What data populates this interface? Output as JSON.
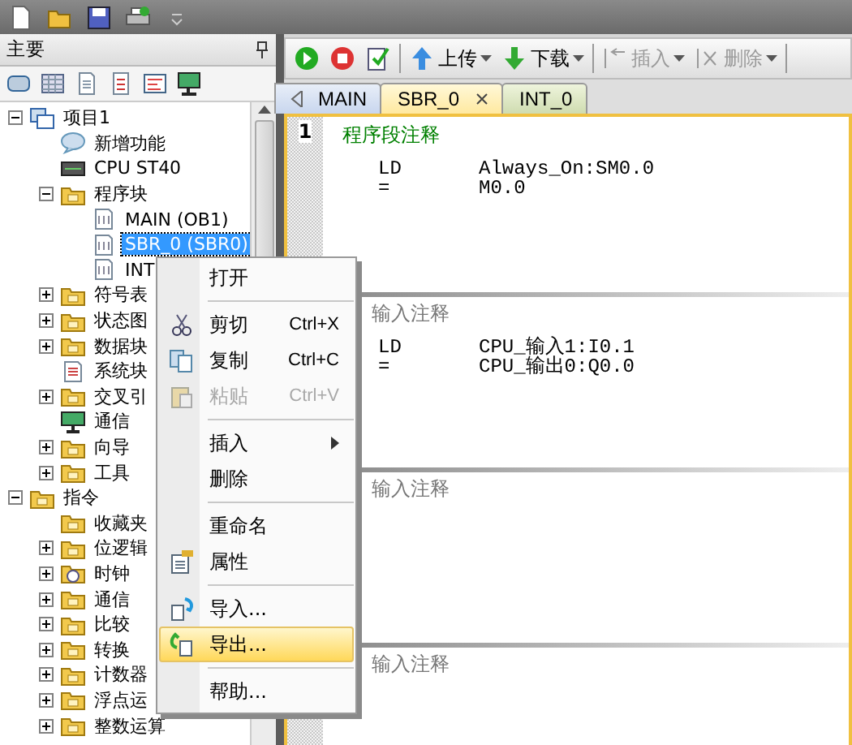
{
  "quick_toolbar": {
    "items": [
      {
        "kind": "new"
      },
      {
        "kind": "open"
      },
      {
        "kind": "save"
      },
      {
        "kind": "print"
      },
      {
        "kind": "more"
      }
    ]
  },
  "left_panel": {
    "title": "主要",
    "icons": [
      {
        "kind": "tag"
      },
      {
        "kind": "grid"
      },
      {
        "kind": "doc"
      },
      {
        "kind": "list"
      },
      {
        "kind": "lines"
      },
      {
        "kind": "monitor"
      }
    ],
    "tree": [
      {
        "label": "项目1",
        "kind": "project",
        "expanded": true,
        "selected": false,
        "children": [
          {
            "label": "新增功能",
            "kind": "help",
            "selected": false
          },
          {
            "label": "CPU ST40",
            "kind": "cpu",
            "selected": false
          },
          {
            "label": "程序块",
            "kind": "folder",
            "expanded": true,
            "selected": false,
            "children": [
              {
                "label": "MAIN (OB1)",
                "kind": "block",
                "selected": false
              },
              {
                "label": "SBR_0 (SBR0)",
                "kind": "block",
                "selected": true
              },
              {
                "label": "INT",
                "kind": "block",
                "selected": false
              }
            ]
          },
          {
            "label": "符号表",
            "kind": "folder",
            "expanded": false,
            "selected": false
          },
          {
            "label": "状态图",
            "kind": "folder",
            "expanded": false,
            "selected": false
          },
          {
            "label": "数据块",
            "kind": "folder",
            "expanded": false,
            "selected": false
          },
          {
            "label": "系统块",
            "kind": "doc",
            "selected": false
          },
          {
            "label": "交叉引",
            "kind": "folder",
            "expanded": false,
            "selected": false
          },
          {
            "label": "通信",
            "kind": "monitor",
            "selected": false
          },
          {
            "label": "向导",
            "kind": "folder",
            "expanded": false,
            "selected": false
          },
          {
            "label": "工具",
            "kind": "folder",
            "expanded": false,
            "selected": false
          }
        ]
      },
      {
        "label": "指令",
        "kind": "folder",
        "expanded": true,
        "selected": false,
        "children": [
          {
            "label": "收藏夹",
            "kind": "folder",
            "selected": false
          },
          {
            "label": "位逻辑",
            "kind": "folder",
            "expanded": false,
            "selected": false
          },
          {
            "label": "时钟",
            "kind": "clock",
            "expanded": false,
            "selected": false
          },
          {
            "label": "通信",
            "kind": "folder",
            "expanded": false,
            "selected": false
          },
          {
            "label": "比较",
            "kind": "folder",
            "expanded": false,
            "selected": false
          },
          {
            "label": "转换",
            "kind": "folder",
            "expanded": false,
            "selected": false
          },
          {
            "label": "计数器",
            "kind": "folder",
            "expanded": false,
            "selected": false
          },
          {
            "label": "浮点运",
            "kind": "folder",
            "expanded": false,
            "selected": false
          },
          {
            "label": "整数运算",
            "kind": "folder",
            "expanded": false,
            "selected": false
          }
        ]
      }
    ]
  },
  "editor_toolbar": [
    {
      "kind": "run"
    },
    {
      "kind": "stop"
    },
    {
      "kind": "check"
    },
    {
      "kind": "separator"
    },
    {
      "kind": "upload",
      "label": "上传",
      "disabled": false
    },
    {
      "kind": "download",
      "label": "下载",
      "disabled": false
    },
    {
      "kind": "separator"
    },
    {
      "kind": "insert",
      "label": "插入",
      "disabled": true
    },
    {
      "kind": "delete",
      "label": "删除",
      "disabled": true
    },
    {
      "kind": "separator"
    }
  ],
  "tabs": [
    {
      "label": "MAIN",
      "selected": false
    },
    {
      "label": "SBR_0",
      "selected": true
    },
    {
      "label": "INT_0",
      "selected": false
    }
  ],
  "networks": [
    {
      "number": "1",
      "comment": "程序段注释",
      "lines": [
        {
          "op": "LD",
          "operand": "Always_On:SM0.0"
        },
        {
          "op": "=",
          "operand": "M0.0"
        }
      ]
    },
    {
      "placeholder": "输入注释",
      "lines": [
        {
          "op": "LD",
          "operand": "CPU_输入1:I0.1"
        },
        {
          "op": "=",
          "operand": "CPU_输出0:Q0.0"
        }
      ]
    },
    {
      "placeholder": "输入注释"
    },
    {
      "placeholder": "输入注释"
    }
  ],
  "context_menu": [
    {
      "kind": "plain",
      "label": "打开",
      "disabled": false,
      "selected": false
    },
    {
      "kind": "separator"
    },
    {
      "kind": "cut",
      "label": "剪切",
      "shortcut": "Ctrl+X",
      "disabled": false,
      "selected": false
    },
    {
      "kind": "copy",
      "label": "复制",
      "shortcut": "Ctrl+C",
      "disabled": false,
      "selected": false
    },
    {
      "kind": "paste",
      "label": "粘贴",
      "shortcut": "Ctrl+V",
      "disabled": true,
      "selected": false
    },
    {
      "kind": "separator"
    },
    {
      "kind": "plain",
      "label": "插入",
      "submenu": true,
      "disabled": false,
      "selected": false
    },
    {
      "kind": "plain",
      "label": "删除",
      "disabled": false,
      "selected": false
    },
    {
      "kind": "separator"
    },
    {
      "kind": "plain",
      "label": "重命名",
      "disabled": false,
      "selected": false
    },
    {
      "kind": "properties",
      "label": "属性",
      "disabled": false,
      "selected": false
    },
    {
      "kind": "separator"
    },
    {
      "kind": "import",
      "label": "导入...",
      "disabled": false,
      "selected": false
    },
    {
      "kind": "export",
      "label": "导出...",
      "disabled": false,
      "selected": true
    },
    {
      "kind": "separator"
    },
    {
      "kind": "plain",
      "label": "帮助...",
      "disabled": false,
      "selected": false
    }
  ]
}
